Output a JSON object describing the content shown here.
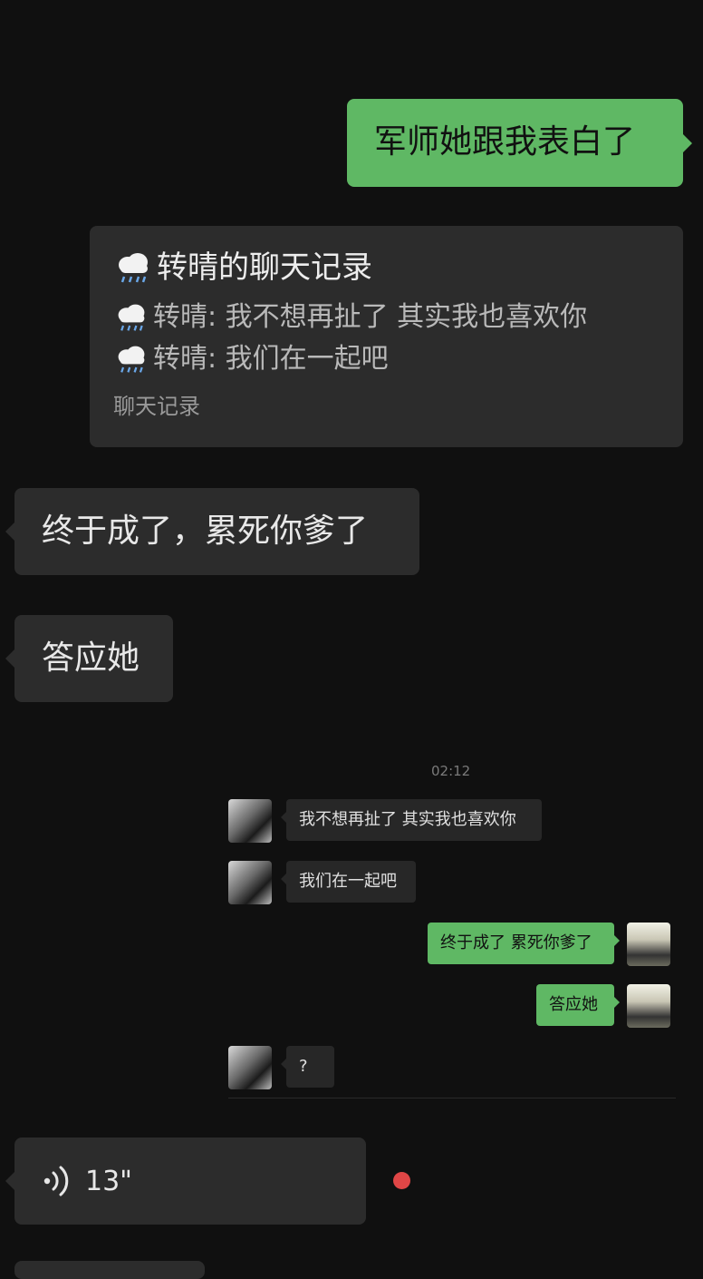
{
  "messages": {
    "m1": "军师她跟我表白了",
    "record": {
      "title": "转晴的聊天记录",
      "lines": [
        "转晴: 我不想再扯了 其实我也喜欢你",
        "转晴: 我们在一起吧"
      ],
      "footer": "聊天记录"
    },
    "m2": "终于成了，累死你爹了",
    "m3": "答应她",
    "voice_duration": "13\""
  },
  "screenshot": {
    "time": "02:12",
    "in1": "我不想再扯了 其实我也喜欢你",
    "in2": "我们在一起吧",
    "out1": "终于成了 累死你爹了",
    "out2": "答应她",
    "in3": "?"
  },
  "icons": {
    "record_icon": "rain-cloud-icon",
    "voice_icon": "voice-wave-icon",
    "unread": "red-dot-icon"
  },
  "colors": {
    "background": "#101010",
    "bubble_in": "#2c2c2c",
    "bubble_out": "#5fb864",
    "unread_dot": "#e04646"
  }
}
